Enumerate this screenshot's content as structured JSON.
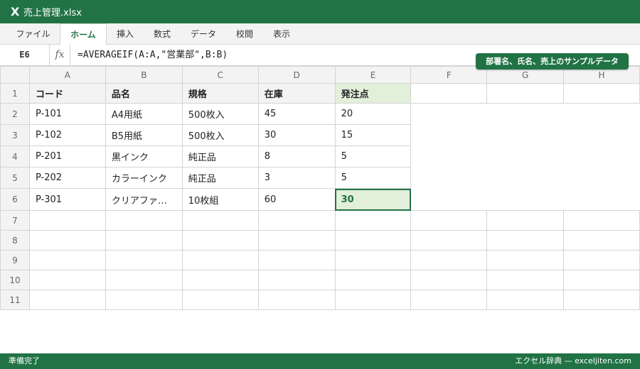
{
  "window": {
    "logo": "X",
    "filename": "売上管理.xlsx"
  },
  "ribbon": {
    "tabs": [
      "ファイル",
      "ホーム",
      "挿入",
      "数式",
      "データ",
      "校閲",
      "表示"
    ],
    "active": "ホーム"
  },
  "formula_bar": {
    "cell_ref": "E6",
    "fx": "fx",
    "formula": "=AVERAGEIF(A:A,\"営業部\",B:B)"
  },
  "badge": "部署名、氏名、売上のサンプルデータ",
  "sheet": {
    "columns": [
      "A",
      "B",
      "C",
      "D",
      "E",
      "F",
      "G",
      "H"
    ],
    "rows": [
      "1",
      "2",
      "3",
      "4",
      "5",
      "6",
      "7",
      "8",
      "9",
      "10",
      "11"
    ],
    "header": [
      "コード",
      "品名",
      "規格",
      "在庫",
      "発注点"
    ],
    "data": [
      [
        "P-101",
        "A4用紙",
        "500枚入",
        "45",
        "20"
      ],
      [
        "P-102",
        "B5用紙",
        "500枚入",
        "30",
        "15"
      ],
      [
        "P-201",
        "黒インク",
        "純正品",
        "8",
        "5"
      ],
      [
        "P-202",
        "カラーインク",
        "純正品",
        "3",
        "5"
      ],
      [
        "P-301",
        "クリアファ…",
        "10枚組",
        "60",
        "30"
      ]
    ],
    "selected_cell": "E6"
  },
  "status_bar": {
    "left": "準備完了",
    "right": "エクセル辞典 — exceljiten.com"
  },
  "colors": {
    "accent": "#217346",
    "highlight": "#e2efda",
    "grid": "#d4d4d4",
    "header_bg": "#f3f3f3"
  }
}
